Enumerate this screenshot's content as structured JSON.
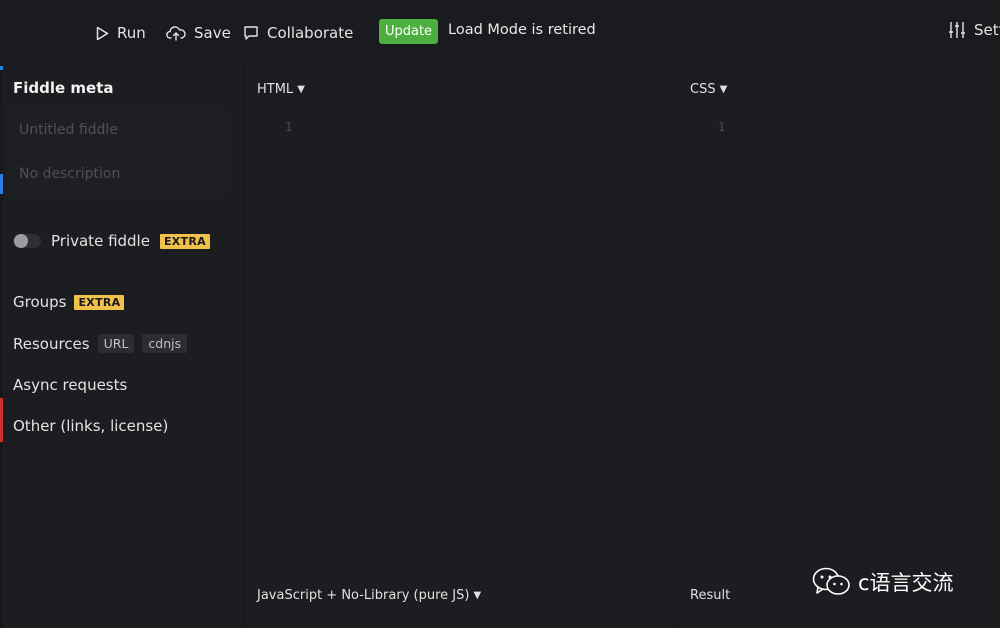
{
  "toolbar": {
    "run_label": "Run",
    "save_label": "Save",
    "collaborate_label": "Collaborate",
    "update_label": "Update",
    "load_mode_text": "Load Mode is retired",
    "settings_label": "Sett"
  },
  "sidebar": {
    "title": "Fiddle meta",
    "title_placeholder": "Untitled fiddle",
    "description_placeholder": "No description",
    "private_label": "Private fiddle",
    "private_badge": "EXTRA",
    "groups_label": "Groups",
    "groups_badge": "EXTRA",
    "resources_label": "Resources",
    "resources_chips": [
      "URL",
      "cdnjs"
    ],
    "async_label": "Async requests",
    "other_label": "Other (links, license)"
  },
  "panels": {
    "html_label": "HTML",
    "html_line": "1",
    "css_label": "CSS",
    "css_line": "1",
    "js_label": "JavaScript + No-Library (pure JS)",
    "result_label": "Result"
  },
  "watermark": {
    "text": "c语言交流"
  },
  "colors": {
    "background": "#1c1d20",
    "update_green": "#4caf3f",
    "extra_badge": "#f0c24b",
    "accent_blue": "#2a7de1",
    "accent_red": "#d0312d"
  },
  "icons": [
    "play-icon",
    "cloud-upload-icon",
    "comment-icon",
    "sliders-icon",
    "caret-down-icon",
    "wechat-icon"
  ]
}
